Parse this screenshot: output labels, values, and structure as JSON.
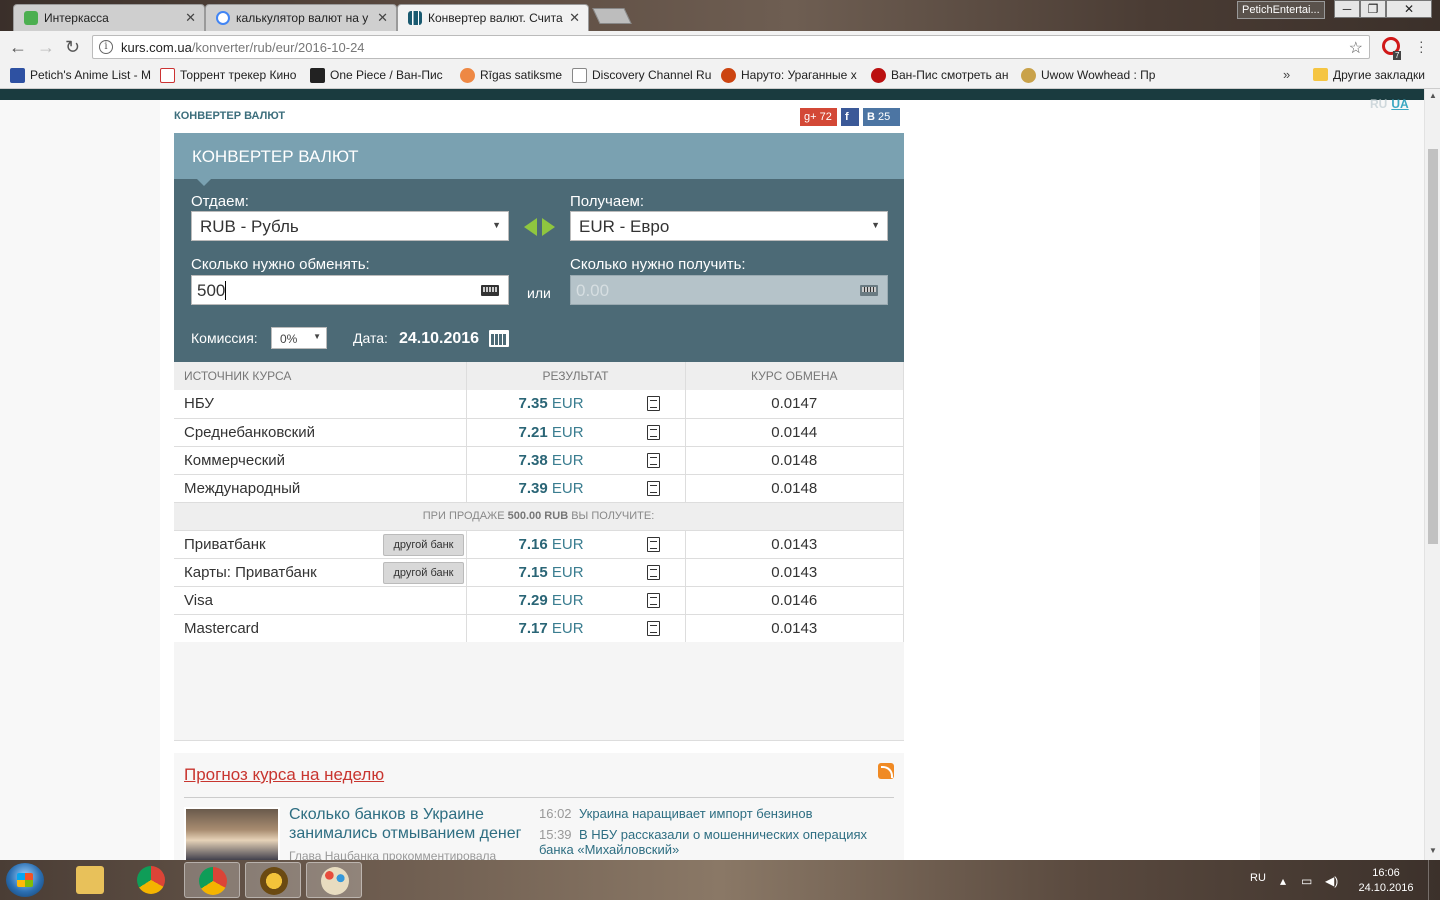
{
  "browser": {
    "tabs": [
      {
        "title": "Интеркасса",
        "icon": "green-person-icon"
      },
      {
        "title": "калькулятор валют на у",
        "icon": "google-icon"
      },
      {
        "title": "Конвертер валют. Счита",
        "icon": "kurs-icon",
        "active": true
      }
    ],
    "user_label": "PetichEntertai...",
    "window_buttons": {
      "minimize": "─",
      "maximize": "❐",
      "close": "✕"
    },
    "url_host": "kurs.com.ua",
    "url_path": "/konverter/rub/eur/2016-10-24",
    "extension_badge": "7",
    "bookmarks": [
      "Petich's Anime List - M",
      "Торрент трекер Кино",
      "One Piece / Ван-Пис",
      "Rīgas satiksme",
      "Discovery Channel Ru",
      "Наруто: Ураганные х",
      "Ван-Пис смотреть ан",
      "Uwow Wowhead : Пр"
    ],
    "bookmarks_more": "»",
    "other_bookmarks": "Другие закладки"
  },
  "page": {
    "langs": {
      "ru": "RU",
      "ua": "UA"
    },
    "section_title": "КОНВЕРТЕР ВАЛЮТ",
    "social": {
      "gplus": "72",
      "facebook": "f",
      "vk": "25",
      "gplus_label": "g+",
      "vk_label": "B"
    },
    "converter": {
      "title": "КОНВЕРТЕР ВАЛЮТ",
      "give_label": "Отдаем:",
      "give_currency": "RUB - Рубль",
      "receive_label": "Получаем:",
      "receive_currency": "EUR - Евро",
      "amount_give_label": "Сколько нужно обменять:",
      "amount_give_value": "500",
      "or_label": "или",
      "amount_receive_label": "Сколько нужно получить:",
      "amount_receive_placeholder": "0.00",
      "commission_label": "Комиссия:",
      "commission_value": "0%",
      "date_label": "Дата:",
      "date_value": "24.10.2016"
    },
    "table": {
      "headers": {
        "source": "ИСТОЧНИК КУРСА",
        "result": "РЕЗУЛЬТАТ",
        "rate": "КУРС ОБМЕНА"
      },
      "rows": [
        {
          "name": "НБУ",
          "amount": "7.35",
          "currency": "EUR",
          "rate": "0.0147"
        },
        {
          "name": "Среднебанковский",
          "amount": "7.21",
          "currency": "EUR",
          "rate": "0.0144"
        },
        {
          "name": "Коммерческий",
          "amount": "7.38",
          "currency": "EUR",
          "rate": "0.0148"
        },
        {
          "name": "Международный",
          "amount": "7.39",
          "currency": "EUR",
          "rate": "0.0148"
        }
      ],
      "separator": {
        "prefix": "ПРИ ПРОДАЖЕ",
        "amount": "500.00 RUB",
        "suffix": "ВЫ ПОЛУЧИТЕ:"
      },
      "bank_rows": [
        {
          "name": "Приватбанк",
          "amount": "7.16",
          "currency": "EUR",
          "rate": "0.0143",
          "button": "другой банк"
        },
        {
          "name": "Карты: Приватбанк",
          "amount": "7.15",
          "currency": "EUR",
          "rate": "0.0143",
          "button": "другой банк"
        },
        {
          "name": "Visa",
          "amount": "7.29",
          "currency": "EUR",
          "rate": "0.0146"
        },
        {
          "name": "Mastercard",
          "amount": "7.17",
          "currency": "EUR",
          "rate": "0.0143"
        }
      ]
    },
    "forecast": {
      "title": "Прогноз курса на неделю",
      "main_news": "Сколько банков в Украине занимались отмыванием денег",
      "main_news_sub": "Глава Нацбанка прокомментировала",
      "news": [
        {
          "time": "16:02",
          "text": "Украина наращивает импорт бензинов"
        },
        {
          "time": "15:39",
          "text": "В НБУ рассказали о мошеннических операциях банка «Михайловский»"
        }
      ]
    }
  },
  "taskbar": {
    "lang": "RU",
    "time": "16:06",
    "date": "24.10.2016"
  }
}
